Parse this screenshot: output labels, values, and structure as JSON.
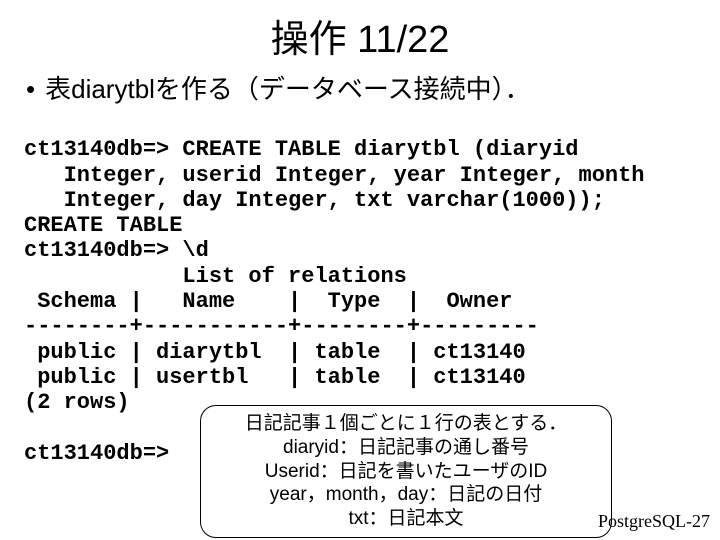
{
  "title": "操作 11/22",
  "bullet": "表diarytblを作る（データベース接続中）．",
  "code_lines": [
    "ct13140db=> CREATE TABLE diarytbl (diaryid",
    "   Integer, userid Integer, year Integer, month",
    "   Integer, day Integer, txt varchar(1000));",
    "CREATE TABLE",
    "ct13140db=> \\d",
    "            List of relations",
    " Schema |   Name    |  Type  |  Owner",
    "--------+-----------+--------+---------",
    " public | diarytbl  | table  | ct13140",
    " public | usertbl   | table  | ct13140",
    "(2 rows)",
    "",
    "ct13140db=>"
  ],
  "callout": {
    "l1": "日記記事１個ごとに１行の表とする．",
    "l2": "diaryid：日記記事の通し番号",
    "l3": "Userid：日記を書いたユーザのID",
    "l4": "year，month，day：日記の日付",
    "l5": "txt：日記本文"
  },
  "footer": "PostgreSQL-27"
}
